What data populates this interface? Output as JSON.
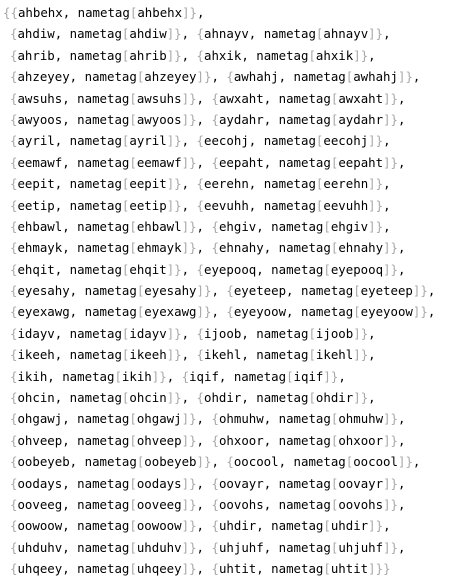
{
  "output": {
    "lines": [
      "{{ahbehx, nametag[ahbehx]},",
      "{ahdiw, nametag[ahdiw]}, {ahnayv, nametag[ahnayv]},",
      "{ahrib, nametag[ahrib]}, {ahxik, nametag[ahxik]},",
      "{ahzeyey, nametag[ahzeyey]}, {awhahj, nametag[awhahj]},",
      "{awsuhs, nametag[awsuhs]}, {awxaht, nametag[awxaht]},",
      "{awyoos, nametag[awyoos]}, {aydahr, nametag[aydahr]},",
      "{ayril, nametag[ayril]}, {eecohj, nametag[eecohj]},",
      "{eemawf, nametag[eemawf]}, {eepaht, nametag[eepaht]},",
      "{eepit, nametag[eepit]}, {eerehn, nametag[eerehn]},",
      "{eetip, nametag[eetip]}, {eevuhh, nametag[eevuhh]},",
      "{ehbawl, nametag[ehbawl]}, {ehgiv, nametag[ehgiv]},",
      "{ehmayk, nametag[ehmayk]}, {ehnahy, nametag[ehnahy]},",
      "{ehqit, nametag[ehqit]}, {eyepooq, nametag[eyepooq]},",
      "{eyesahy, nametag[eyesahy]}, {eyeteep, nametag[eyeteep]},",
      "{eyexawg, nametag[eyexawg]}, {eyeyoow, nametag[eyeyoow]},",
      "{idayv, nametag[idayv]}, {ijoob, nametag[ijoob]},",
      "{ikeeh, nametag[ikeeh]}, {ikehl, nametag[ikehl]},",
      "{ikih, nametag[ikih]}, {iqif, nametag[iqif]},",
      "{ohcin, nametag[ohcin]}, {ohdir, nametag[ohdir]},",
      "{ohgawj, nametag[ohgawj]}, {ohmuhw, nametag[ohmuhw]},",
      "{ohveep, nametag[ohveep]}, {ohxoor, nametag[ohxoor]},",
      "{oobeyeb, nametag[oobeyeb]}, {oocool, nametag[oocool]},",
      "{oodays, nametag[oodays]}, {oovayr, nametag[oovayr]},",
      "{ooveeg, nametag[ooveeg]}, {oovohs, nametag[oovohs]},",
      "{oowoow, nametag[oowoow]}, {uhdir, nametag[uhdir]},",
      "{uhduhv, nametag[uhduhv]}, {uhjuhf, nametag[uhjuhf]},",
      "{uhqeey, nametag[uhqeey]}, {uhtit, nametag[uhtit]}}"
    ],
    "bracket_color": "#a8a8a8",
    "text_color": "#000000"
  }
}
